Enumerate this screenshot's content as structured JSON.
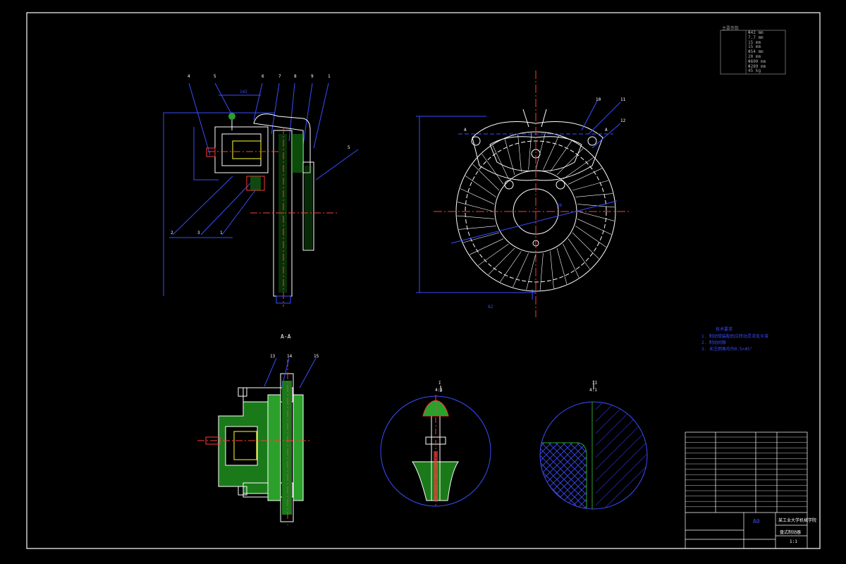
{
  "section_views": {
    "aa_title": "A-A",
    "detail_1_title": "I",
    "detail_1_scale": "4:1",
    "detail_2_title": "II",
    "detail_2_scale": "4:1",
    "section_marker_a": "A"
  },
  "balloons": {
    "side_view_top": [
      "4",
      "5",
      "6",
      "7",
      "8",
      "9",
      "1"
    ],
    "side_view_bottom": [
      "2",
      "3",
      "1"
    ],
    "front_view": [
      "10",
      "11",
      "12"
    ],
    "section_view": [
      "13",
      "14",
      "15"
    ],
    "right_callout": "5"
  },
  "dimensions": {
    "side_width": "142",
    "front_width": "46",
    "bottom_center": "82"
  },
  "spec_table": {
    "heading": "主要参数",
    "values": [
      "Φ42 mm",
      "7.7 mm",
      "15 mm",
      "15 mm",
      "Φ54 mm",
      "20 mm",
      "Φ600 mm",
      "Φ289 mm",
      "45 kg"
    ]
  },
  "tech_requirements": {
    "heading": "技术要求",
    "items": [
      "1. 制动钳装配后应转动灵活无卡滞",
      "2. 制动间隙",
      "3. 未注倒角均为0.5×45°"
    ]
  },
  "title_block": {
    "sheet": "A0",
    "university": "某工业大学机械学院",
    "drawing_name": "盘式制动器",
    "scale": "1:1"
  },
  "colors": {
    "background": "#000000",
    "lines": "#ffffff",
    "dimension": "#3a4dff",
    "hatch": "#22cc22",
    "centerline": "#ff3a3a",
    "accent": "#ffff33"
  }
}
